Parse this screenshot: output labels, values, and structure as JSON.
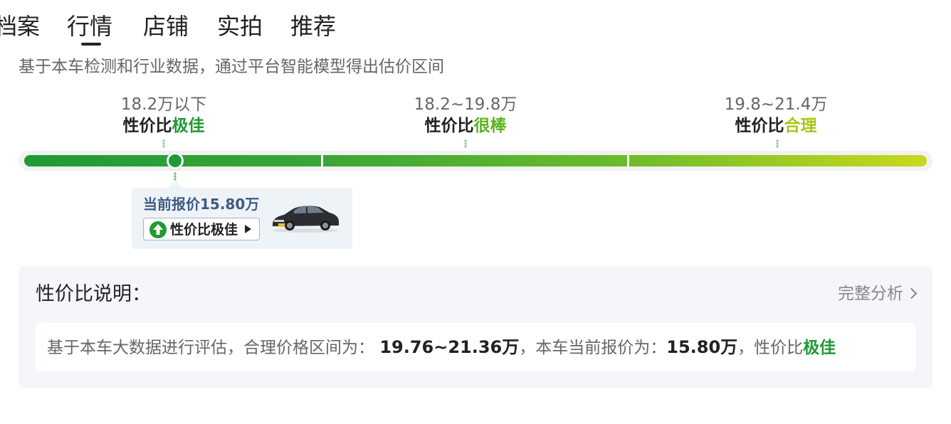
{
  "tabs": [
    {
      "label": "档案"
    },
    {
      "label": "行情"
    },
    {
      "label": "店铺"
    },
    {
      "label": "实拍"
    },
    {
      "label": "推荐"
    }
  ],
  "intro": "基于本车检测和行业数据，通过平台智能模型得出估价区间",
  "segments": [
    {
      "range": "18.2万以下",
      "prefix": "性价比",
      "rating": "极佳",
      "color": "#1f9a34"
    },
    {
      "range": "18.2~19.8万",
      "prefix": "性价比",
      "rating": "很棒",
      "color": "#5cb320"
    },
    {
      "range": "19.8~21.4万",
      "prefix": "性价比",
      "rating": "合理",
      "color": "#a8c414"
    }
  ],
  "bar_colors": [
    "#1f9a34",
    "#6bbb2a",
    "#c9d81e"
  ],
  "current": {
    "price_text": "当前报价15.80万",
    "badge_label": "性价比极佳",
    "price_value": 15.8,
    "badge_icon": "up-arrow-icon",
    "image": "car-image"
  },
  "explain": {
    "title": "性价比说明：",
    "link_label": "完整分析",
    "link_icon": "chevron-right-icon",
    "text_1": "基于本车大数据进行评估，合理价格区间为：",
    "range": "19.76~21.36万",
    "text_2": "，本车当前报价为：",
    "price": "15.80万",
    "text_3": "，性价比",
    "rating": "极佳"
  }
}
